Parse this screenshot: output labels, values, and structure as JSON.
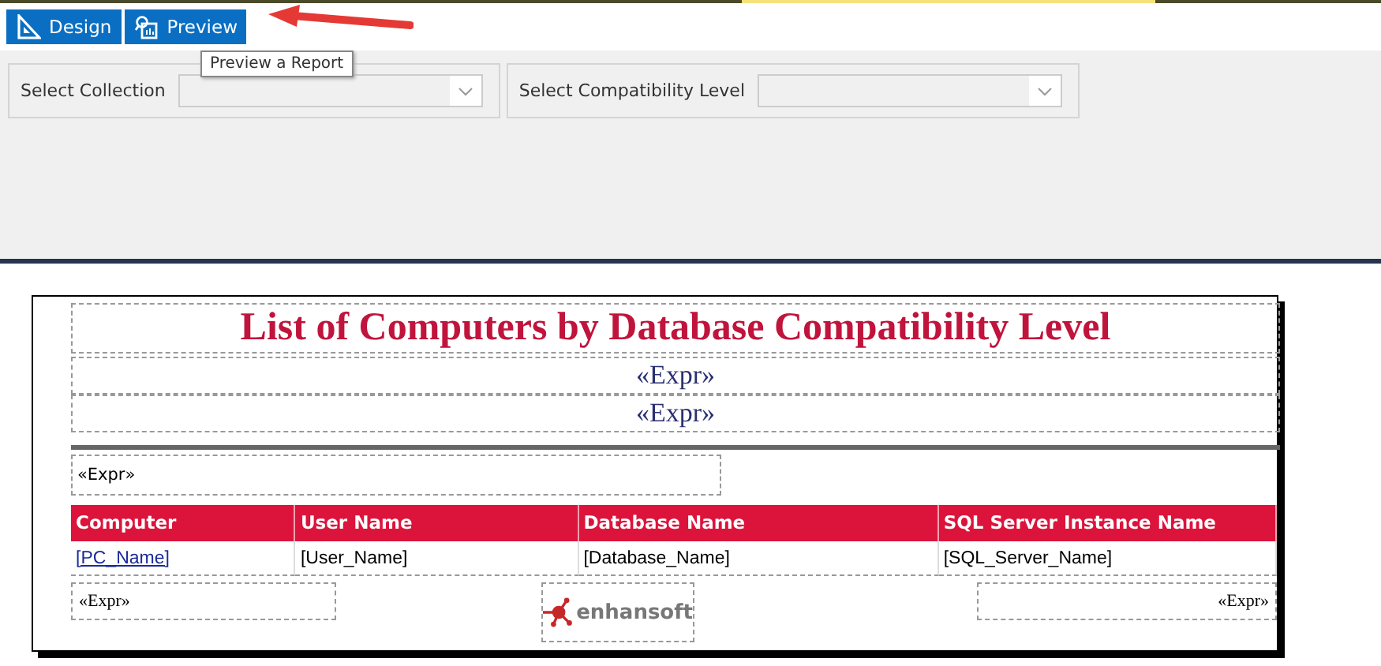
{
  "toolbar": {
    "buttons": [
      {
        "label": "Design",
        "kind": "design"
      },
      {
        "label": "Preview",
        "kind": "preview"
      }
    ],
    "tooltip": "Preview a Report"
  },
  "filters": [
    {
      "label": "Select Collection"
    },
    {
      "label": "Select Compatibility Level"
    }
  ],
  "report": {
    "title": "List of Computers by Database Compatibility Level",
    "subtitles": [
      "«Expr»",
      "«Expr»"
    ],
    "group_expr": "«Expr»",
    "columns": [
      "Computer",
      "User Name",
      "Database Name",
      "SQL Server Instance Name"
    ],
    "row": [
      {
        "text": "[PC_Name]",
        "kind": "link"
      },
      {
        "text": "[User_Name]",
        "kind": "text"
      },
      {
        "text": "[Database_Name]",
        "kind": "text"
      },
      {
        "text": "[SQL_Server_Name]",
        "kind": "text"
      }
    ],
    "footer_left": "«Expr»",
    "logo_text": "enhansoft",
    "footer_right": "«Expr»"
  }
}
